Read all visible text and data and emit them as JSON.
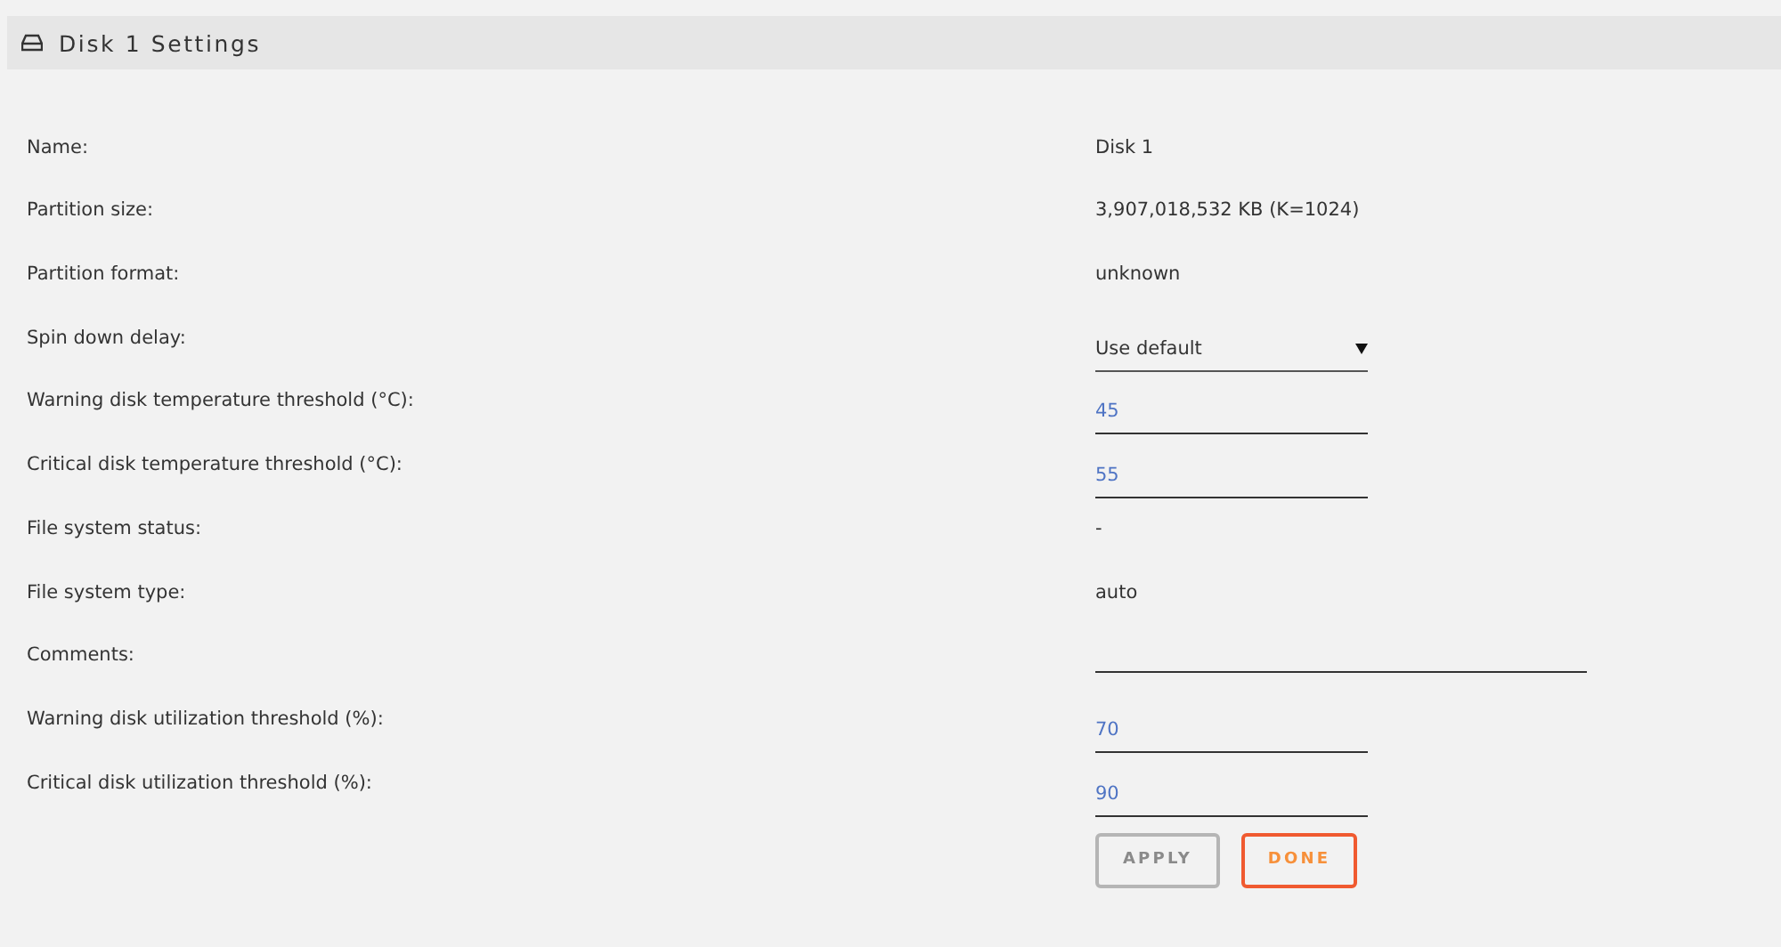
{
  "panel": {
    "title": "Disk 1 Settings"
  },
  "fields": [
    {
      "label": "Name:",
      "kind": "text",
      "value": "Disk 1"
    },
    {
      "label": "Partition size:",
      "kind": "text",
      "value": "3,907,018,532 KB (K=1024)"
    },
    {
      "label": "Partition format:",
      "kind": "text",
      "value": "unknown"
    },
    {
      "label": "Spin down delay:",
      "kind": "select",
      "value": "Use default"
    },
    {
      "label": "Warning disk temperature threshold (°C):",
      "kind": "input",
      "value": "45"
    },
    {
      "label": "Critical disk temperature threshold (°C):",
      "kind": "input",
      "value": "55"
    },
    {
      "label": "File system status:",
      "kind": "text",
      "value": "-"
    },
    {
      "label": "File system type:",
      "kind": "text",
      "value": "auto"
    },
    {
      "label": "Comments:",
      "kind": "wide-input"
    },
    {
      "label": "Warning disk utilization threshold (%):",
      "kind": "input",
      "value": "70"
    },
    {
      "label": "Critical disk utilization threshold (%):",
      "kind": "input",
      "value": "90"
    }
  ],
  "buttons": [
    {
      "label": "APPLY",
      "kind": "apply",
      "disabled": true
    },
    {
      "label": "DONE",
      "kind": "done",
      "disabled": false
    }
  ]
}
